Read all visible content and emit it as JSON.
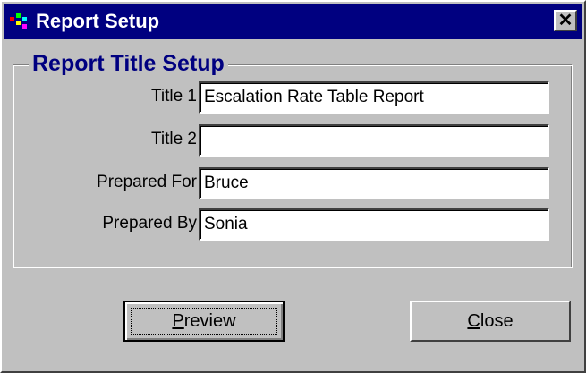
{
  "window": {
    "title": "Report Setup",
    "close_glyph": "✕"
  },
  "group": {
    "legend": "Report Title Setup"
  },
  "fields": [
    {
      "label": "Title 1",
      "value": "Escalation Rate Table Report"
    },
    {
      "label": "Title 2",
      "value": ""
    },
    {
      "label": "Prepared For",
      "value": "Bruce"
    },
    {
      "label": "Prepared By",
      "value": "Sonia"
    }
  ],
  "buttons": {
    "preview": {
      "mnemonic": "P",
      "rest": "review"
    },
    "close": {
      "mnemonic": "C",
      "rest": "lose"
    }
  },
  "colors": {
    "titlebar": "#000080",
    "legend": "#000080",
    "face": "#c0c0c0"
  },
  "icons": {
    "app": "app-icon",
    "close": "close-icon"
  }
}
